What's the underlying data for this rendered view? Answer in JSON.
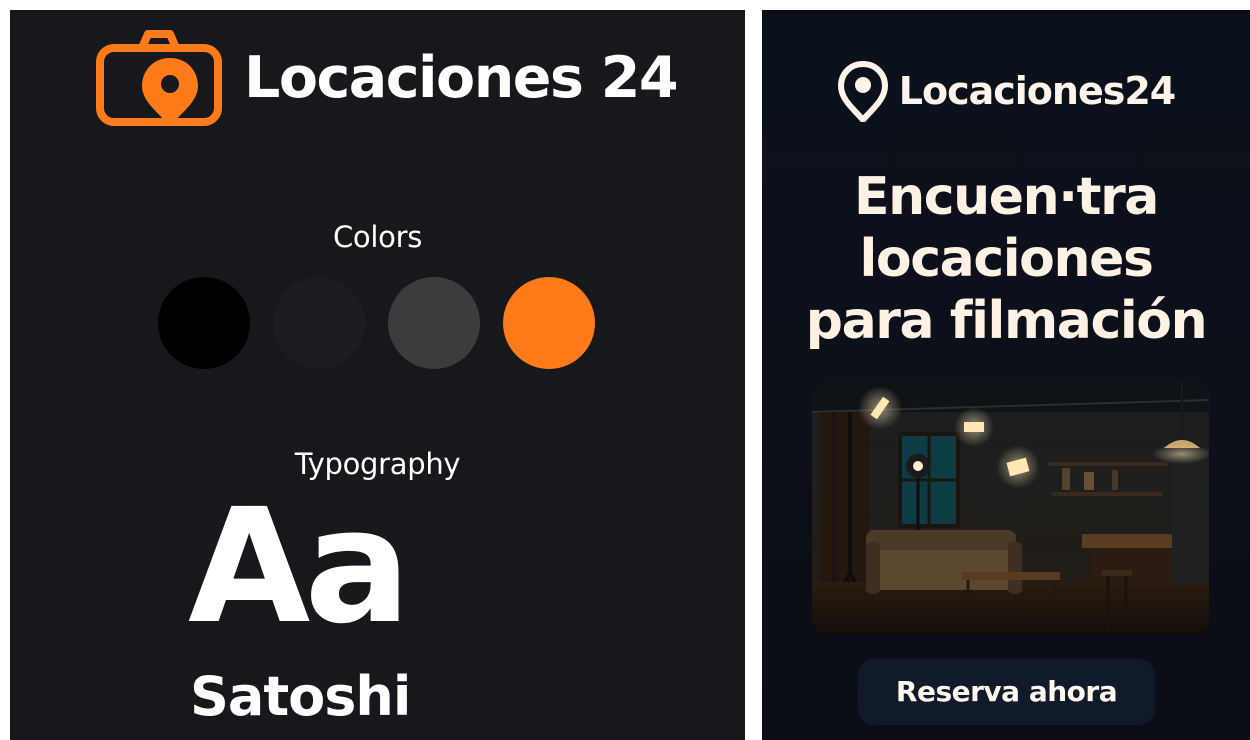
{
  "brand_board": {
    "logo_text": "Locaciones 24",
    "colors_title": "Colors",
    "swatches": [
      "#000000",
      "#1b1d21",
      "#3c3c3e",
      "#ff7a18"
    ],
    "accent_color": "#ff7a18",
    "typography_title": "Typography",
    "type_sample": "Aa",
    "font_name": "Satoshi",
    "logo_icon": "camera-pin-icon"
  },
  "promo": {
    "logo_text": "Locaciones24",
    "logo_icon": "map-pin-icon",
    "headline_lines": [
      "Encuen·tra",
      "locaciones",
      "para filmación"
    ],
    "image_subject": "film-set-room-image",
    "cta_label": "Reserva ahora"
  }
}
